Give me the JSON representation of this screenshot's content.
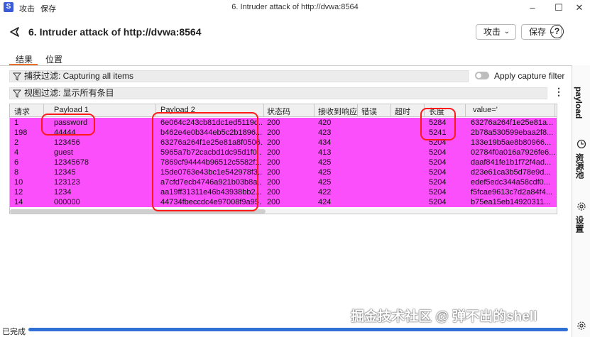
{
  "titlebar": {
    "menu": [
      "攻击",
      "保存"
    ],
    "title": "6. Intruder attack of http://dvwa:8564",
    "minimize_glyph": "–",
    "maximize_glyph": "☐",
    "close_glyph": "✕"
  },
  "header": {
    "title": "6. Intruder attack of http://dvwa:8564",
    "attack_button": "攻击",
    "save_button": "保存",
    "help_glyph": "?"
  },
  "tabs": [
    "结果",
    "位置"
  ],
  "capture_filter": {
    "label": "捕获过滤: Capturing all items",
    "toggle_label": "Apply capture filter",
    "toggle_on": false
  },
  "view_filter": {
    "label": "视图过滤: 显示所有条目",
    "menu_glyph": "⋮"
  },
  "table": {
    "columns": [
      "请求",
      "Payload 1",
      "Payload 2",
      "状态码",
      "接收到响应",
      "错误",
      "超时",
      "长度",
      "value='"
    ],
    "rows": [
      {
        "request": "1",
        "payload1": "password",
        "payload2": "6e064c243cb81dc1ed5119d...",
        "status": "200",
        "received": "420",
        "error": "",
        "timeout": "",
        "length": "5284",
        "value": "63276a264f1e25e81a..."
      },
      {
        "request": "198",
        "payload1": "44444",
        "payload2": "b462e4e0b344eb5c2b1896...",
        "status": "200",
        "received": "423",
        "error": "",
        "timeout": "",
        "length": "5241",
        "value": "2b78a530599ebaa2f8..."
      },
      {
        "request": "2",
        "payload1": "123456",
        "payload2": "63276a264f1e25e81a8f0506...",
        "status": "200",
        "received": "434",
        "error": "",
        "timeout": "",
        "length": "5204",
        "value": "133e19b5ae8b80966..."
      },
      {
        "request": "4",
        "payload1": "guest",
        "payload2": "5965a7b72cacbd1dc95d1f0...",
        "status": "200",
        "received": "413",
        "error": "",
        "timeout": "",
        "length": "5204",
        "value": "02784f0a016a7926fe6..."
      },
      {
        "request": "6",
        "payload1": "12345678",
        "payload2": "7869cf94444b96512c5582f1...",
        "status": "200",
        "received": "425",
        "error": "",
        "timeout": "",
        "length": "5204",
        "value": "daaf841fe1b1f72f4ad..."
      },
      {
        "request": "8",
        "payload1": "12345",
        "payload2": "15de0763e43bc1e542978f3...",
        "status": "200",
        "received": "425",
        "error": "",
        "timeout": "",
        "length": "5204",
        "value": "d23e61ca3b5d78e9d..."
      },
      {
        "request": "10",
        "payload1": "123123",
        "payload2": "a7cfd7ecb4746a921b03b8a...",
        "status": "200",
        "received": "425",
        "error": "",
        "timeout": "",
        "length": "5204",
        "value": "edef5edc344a58cdf0..."
      },
      {
        "request": "12",
        "payload1": "1234",
        "payload2": "aa19ff31311e46b43938bb2...",
        "status": "200",
        "received": "422",
        "error": "",
        "timeout": "",
        "length": "5204",
        "value": "f5fcae9613c7d2a84f4..."
      },
      {
        "request": "14",
        "payload1": "000000",
        "payload2": "44734fbeccdc4e97008f9a95...",
        "status": "200",
        "received": "424",
        "error": "",
        "timeout": "",
        "length": "5204",
        "value": "b75ea15eb14920311..."
      }
    ],
    "highlight_color": "#fc4ffc"
  },
  "sidebar": {
    "tabs": [
      "payload",
      "资源池",
      "设置"
    ]
  },
  "status": {
    "text": "已完成",
    "progress": 1.0
  },
  "watermark": "掘金技术社区 @ 弹不出的shell",
  "colors": {
    "accent": "#e8702a",
    "annotation": "#ff1a1a",
    "progress": "#2f6fd6"
  }
}
